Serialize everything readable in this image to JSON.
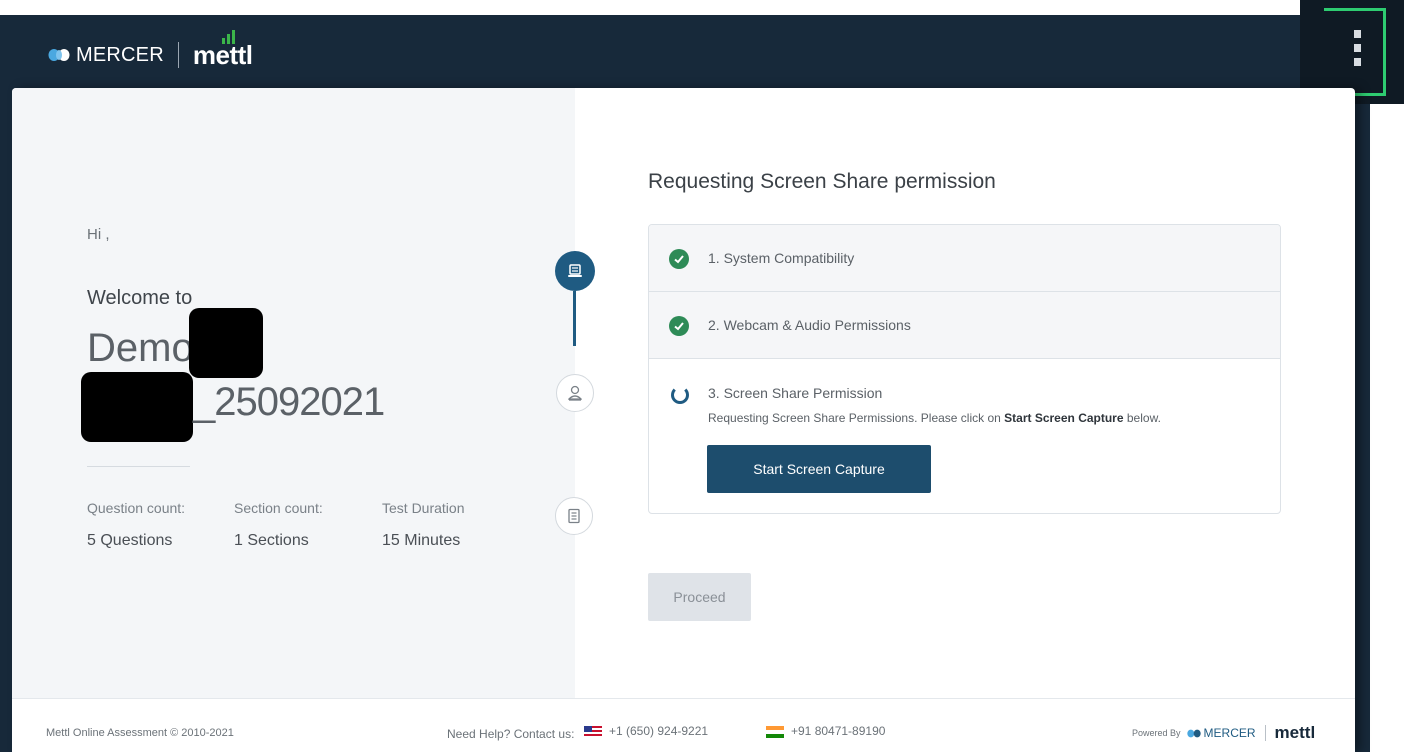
{
  "header": {
    "brand_primary": "MERCER",
    "brand_secondary": "mettl"
  },
  "welcome": {
    "greeting": "Hi ,",
    "welcome_text": "Welcome to",
    "test_name_part1": "Demo",
    "test_name_part2": "_25092021"
  },
  "stats": [
    {
      "label": "Question count:",
      "value": "5 Questions"
    },
    {
      "label": "Section count:",
      "value": "1 Sections"
    },
    {
      "label": "Test Duration",
      "value": "15  Minutes"
    }
  ],
  "stepper": [
    {
      "icon": "laptop-icon",
      "state": "active"
    },
    {
      "icon": "user-icon",
      "state": "inactive"
    },
    {
      "icon": "document-icon",
      "state": "inactive"
    }
  ],
  "permission": {
    "title": "Requesting Screen Share permission",
    "steps": [
      {
        "label": "1. System Compatibility",
        "status": "done"
      },
      {
        "label": "2. Webcam & Audio Permissions",
        "status": "done"
      },
      {
        "label": "3. Screen Share Permission",
        "status": "in-progress"
      }
    ],
    "description_prefix": "Requesting Screen Share Permissions. Please click on",
    "description_bold": "Start Screen Capture",
    "description_suffix": "below.",
    "capture_button": "Start Screen Capture",
    "proceed_button": "Proceed"
  },
  "footer": {
    "copyright": "Mettl Online Assessment © 2010-2021",
    "help_label": "Need Help? Contact us:",
    "phone_us": "+1 (650) 924-9221",
    "phone_in": "+91 80471-89190",
    "powered_by": "Powered By",
    "powered_mercer": "MERCER",
    "powered_mettl": "mettl"
  },
  "colors": {
    "header_bg": "#17293a",
    "accent": "#1f5b82",
    "success": "#2e8b57",
    "corner_accent": "#2ecc71"
  }
}
